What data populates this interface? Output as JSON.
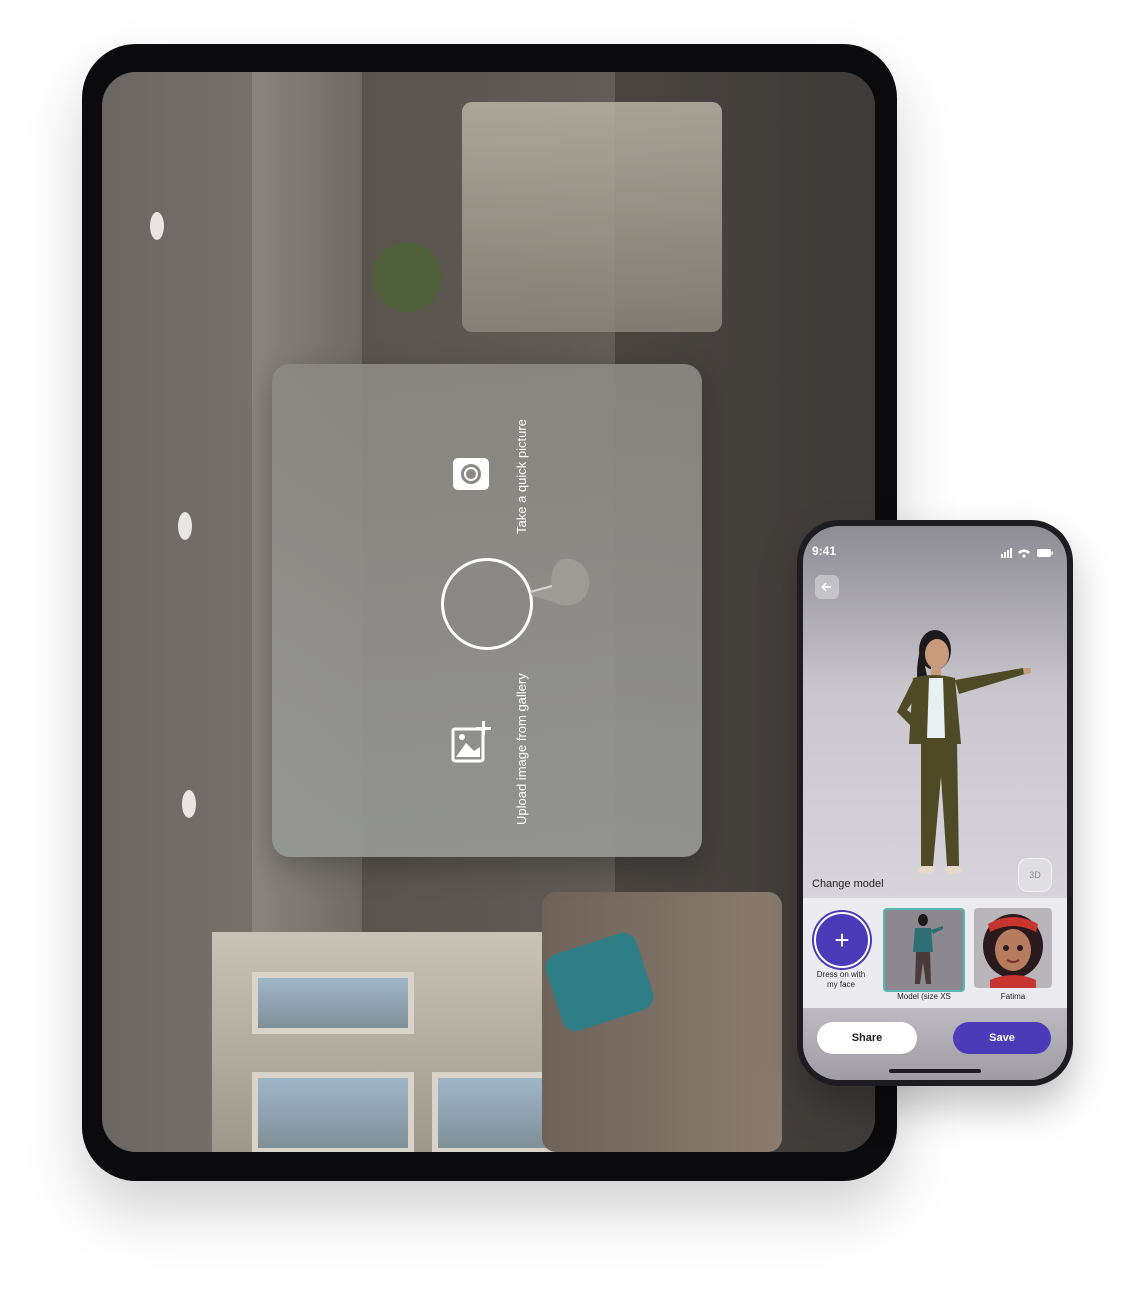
{
  "capture_panel": {
    "quick_picture_label": "Take a quick picture",
    "upload_label": "Upload image from gallery"
  },
  "phone": {
    "status_time": "9:41",
    "change_model_label": "Change model",
    "view_3d_label": "3D",
    "add_button_glyph": "+",
    "dress_label_line1": "Dress on with",
    "dress_label_line2": "my face",
    "models": [
      {
        "label": "Model (size XS",
        "selected": true
      },
      {
        "label": "Fatima",
        "selected": false
      }
    ],
    "share_label": "Share",
    "save_label": "Save",
    "accent_color": "#4b3bb8",
    "selected_border_color": "#58b7b1"
  }
}
